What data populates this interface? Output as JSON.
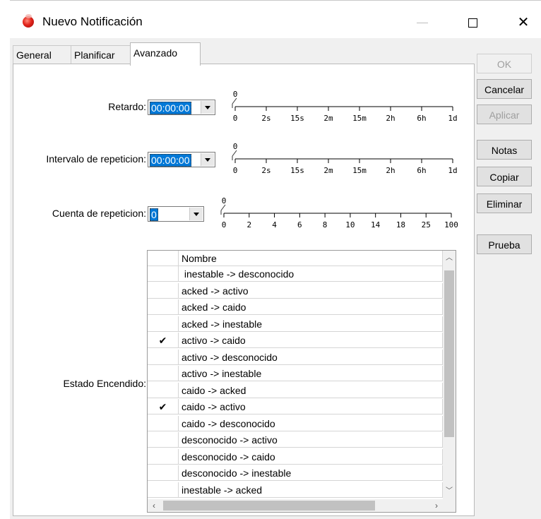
{
  "window": {
    "title": "Nuevo Notificación"
  },
  "tabs": [
    {
      "label": "General",
      "active": false
    },
    {
      "label": "Planificar",
      "active": false
    },
    {
      "label": "Avanzado",
      "active": true
    }
  ],
  "buttons": {
    "ok": "OK",
    "cancel": "Cancelar",
    "apply": "Aplicar",
    "notes": "Notas",
    "copy": "Copiar",
    "delete": "Eliminar",
    "test": "Prueba"
  },
  "fields": {
    "retardo": {
      "label": "Retardo:",
      "value": "00:00:00",
      "slider_value": "0",
      "ticks": [
        "0",
        "2s",
        "15s",
        "2m",
        "15m",
        "2h",
        "6h",
        "1d"
      ]
    },
    "intervalo": {
      "label": "Intervalo de repeticion:",
      "value": "00:00:00",
      "slider_value": "0",
      "ticks": [
        "0",
        "2s",
        "15s",
        "2m",
        "15m",
        "2h",
        "6h",
        "1d"
      ]
    },
    "cuenta": {
      "label": "Cuenta de repeticion:",
      "value": "0",
      "slider_value": "0",
      "ticks": [
        "0",
        "2",
        "4",
        "6",
        "8",
        "10",
        "14",
        "18",
        "25",
        "100"
      ]
    }
  },
  "estado": {
    "label": "Estado Encendido:",
    "column_header": "Nombre",
    "rows": [
      {
        "name": " inestable -> desconocido",
        "checked": false
      },
      {
        "name": "acked -> activo",
        "checked": false
      },
      {
        "name": "acked -> caido",
        "checked": false
      },
      {
        "name": "acked -> inestable",
        "checked": false
      },
      {
        "name": "activo -> caido",
        "checked": true
      },
      {
        "name": "activo -> desconocido",
        "checked": false
      },
      {
        "name": "activo -> inestable",
        "checked": false
      },
      {
        "name": "caido -> acked",
        "checked": false
      },
      {
        "name": "caido -> activo",
        "checked": true
      },
      {
        "name": "caido -> desconocido",
        "checked": false
      },
      {
        "name": "desconocido -> activo",
        "checked": false
      },
      {
        "name": "desconocido -> caido",
        "checked": false
      },
      {
        "name": "desconocido -> inestable",
        "checked": false
      },
      {
        "name": "inestable -> acked",
        "checked": false
      }
    ]
  },
  "colors": {
    "accent": "#0078d7",
    "window_bg": "#f0f0f0"
  }
}
